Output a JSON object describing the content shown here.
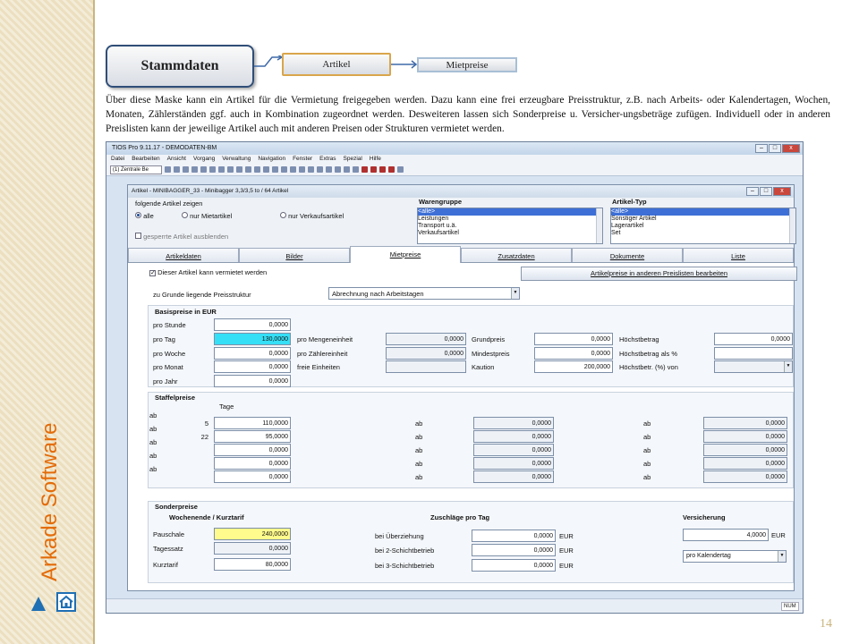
{
  "sidebar": {
    "brand": "Arkade Software",
    "page_number": "14"
  },
  "flow": {
    "step1": "Stammdaten",
    "step2": "Artikel",
    "step3": "Mietpreise"
  },
  "description": "Über diese Maske kann ein Artikel für die Vermietung freigegeben werden. Dazu kann eine frei erzeugbare Preisstruktur, z.B. nach Arbeits- oder Kalendertagen, Wochen, Monaten, Zählerständen ggf. auch in Kombination zugeordnet werden. Desweiteren lassen sich Sonderpreise u. Versicher-ungsbeträge zufügen. Individuell oder in anderen Preislisten kann der jeweilige Artikel auch mit anderen Preisen oder Strukturen vermietet werden.",
  "app": {
    "title": "TIOS Pro 9.11.17 - DEMODATEN-BM",
    "menu": [
      "Datei",
      "Bearbeiten",
      "Ansicht",
      "Vorgang",
      "Verwaltung",
      "Navigation",
      "Fenster",
      "Extras",
      "Spezial",
      "Hilfe"
    ],
    "toolbar_select": "(1) Zentrale Be",
    "status": "NUM"
  },
  "window": {
    "title": "Artikel - MINIBAGGER_33 - Minibagger 3,3/3,5 to / 64 Artikel"
  },
  "filter": {
    "heading": "folgende Artikel zeigen",
    "radio_all": "alle",
    "radio_rent": "nur Mietartikel",
    "radio_sale": "nur Verkaufsartikel",
    "locked": "gesperrte Artikel ausblenden"
  },
  "warengruppe": {
    "label": "Warengruppe",
    "items": [
      "<alle>",
      "Leistungen",
      "Transport u.ä.",
      "Verkaufsartikel"
    ]
  },
  "artikeltyp": {
    "label": "Artikel-Typ",
    "items": [
      "<alle>",
      "Sonstiger Artikel",
      "Lagerartikel",
      "Set"
    ]
  },
  "tabs": [
    "Artikeldaten",
    "Bilder",
    "Mietpreise",
    "Zusatzdaten",
    "Dokumente",
    "Liste"
  ],
  "rentable": "Dieser Artikel kann vermietet werden",
  "other_lists_button": "Artikelpreise in anderen Preislisten bearbeiten",
  "structure": {
    "label": "zu Grunde liegende Preisstruktur",
    "value": "Abrechnung nach Arbeitstagen"
  },
  "basis": {
    "heading": "Basispreise in EUR",
    "rows": [
      {
        "label": "pro Stunde",
        "value": "0,0000"
      },
      {
        "label": "pro Tag",
        "value": "130,0000"
      },
      {
        "label": "pro Woche",
        "value": "0,0000"
      },
      {
        "label": "pro Monat",
        "value": "0,0000"
      },
      {
        "label": "pro Jahr",
        "value": "0,0000"
      }
    ],
    "mid": [
      {
        "label": "pro Mengeneinheit",
        "value": "0,0000"
      },
      {
        "label": "pro Zählereinheit",
        "value": "0,0000"
      },
      {
        "label": "freie Einheiten",
        "value": ""
      }
    ],
    "grund": [
      {
        "label": "Grundpreis",
        "value": "0,0000"
      },
      {
        "label": "Mindestpreis",
        "value": "0,0000"
      },
      {
        "label": "Kaution",
        "value": "200,0000"
      }
    ],
    "hoechst": [
      {
        "label": "Höchstbetrag",
        "value": "0,0000"
      },
      {
        "label": "Höchstbetrag als %",
        "value": ""
      },
      {
        "label": "Höchstbetr. (%) von",
        "value": ""
      }
    ]
  },
  "staffel": {
    "heading": "Staffelpreise",
    "days_header": "Tage",
    "ab": "ab",
    "col1": [
      {
        "days": "5",
        "value": "110,0000"
      },
      {
        "days": "22",
        "value": "95,0000"
      },
      {
        "days": "",
        "value": "0,0000"
      },
      {
        "days": "",
        "value": "0,0000"
      },
      {
        "days": "",
        "value": "0,0000"
      }
    ],
    "col2": [
      "0,0000",
      "0,0000",
      "0,0000",
      "0,0000",
      "0,0000"
    ],
    "col3": [
      "0,0000",
      "0,0000",
      "0,0000",
      "0,0000",
      "0,0000"
    ]
  },
  "sonder": {
    "heading": "Sonderpreise",
    "weekend_heading": "Wochenende / Kurztarif",
    "weekend": [
      {
        "label": "Pauschale",
        "value": "240,0000"
      },
      {
        "label": "Tagessatz",
        "value": "0,0000"
      },
      {
        "label": "Kurztarif",
        "value": "80,0000"
      }
    ],
    "surcharge_heading": "Zuschläge pro Tag",
    "surcharges": [
      {
        "label": "bei Überziehung",
        "value": "0,0000",
        "unit": "EUR"
      },
      {
        "label": "bei 2-Schichtbetrieb",
        "value": "0,0000",
        "unit": "EUR"
      },
      {
        "label": "bei 3-Schichtbetrieb",
        "value": "0,0000",
        "unit": "EUR"
      }
    ],
    "insurance_heading": "Versicherung",
    "insurance_value": "4,0000",
    "insurance_unit": "EUR",
    "insurance_mode": "pro Kalendertag"
  }
}
